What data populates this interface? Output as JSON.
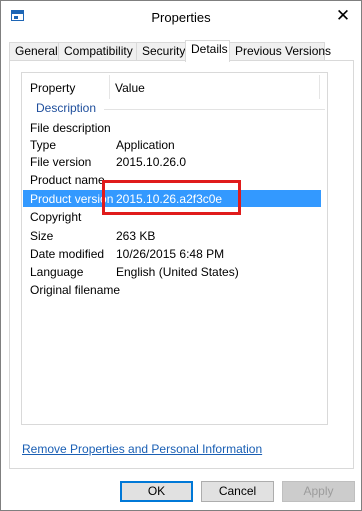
{
  "window": {
    "title": "Properties",
    "close_glyph": "✕"
  },
  "tabs": [
    {
      "label": "General"
    },
    {
      "label": "Compatibility"
    },
    {
      "label": "Security"
    },
    {
      "label": "Details",
      "active": true
    },
    {
      "label": "Previous Versions"
    }
  ],
  "list": {
    "columns": {
      "property": "Property",
      "value": "Value"
    },
    "section": "Description",
    "rows": [
      {
        "property": "File description",
        "value": ""
      },
      {
        "property": "Type",
        "value": "Application"
      },
      {
        "property": "File version",
        "value": "2015.10.26.0"
      },
      {
        "property": "Product name",
        "value": ""
      },
      {
        "property": "Product version",
        "value": "2015.10.26.a2f3c0e",
        "selected": true
      },
      {
        "property": "Copyright",
        "value": ""
      },
      {
        "property": "Size",
        "value": "263 KB"
      },
      {
        "property": "Date modified",
        "value": "10/26/2015 6:48 PM"
      },
      {
        "property": "Language",
        "value": "English (United States)"
      },
      {
        "property": "Original filename",
        "value": ""
      }
    ]
  },
  "link": {
    "label": "Remove Properties and Personal Information"
  },
  "buttons": {
    "ok": "OK",
    "cancel": "Cancel",
    "apply": "Apply"
  },
  "colors": {
    "selection": "#3399ff",
    "highlight_box": "#e01b1b",
    "link": "#1a5fb4"
  }
}
